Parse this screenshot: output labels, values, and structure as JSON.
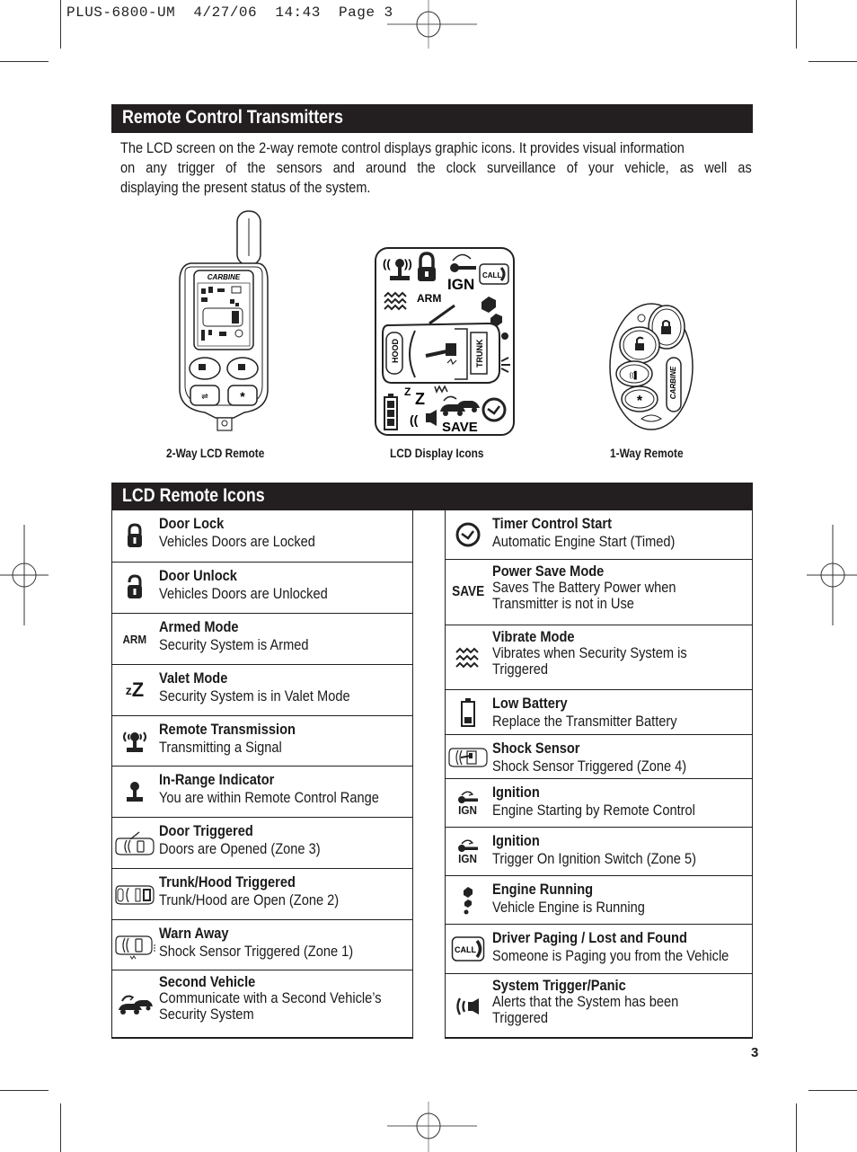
{
  "slug": {
    "text": "PLUS-6800-UM  4/27/06  14:43  Page 3"
  },
  "section1": {
    "title": "Remote Control Transmitters",
    "intro_lines": [
      "The LCD screen on the 2-way remote control displays graphic icons. It provides visual information",
      "on any trigger of the sensors and around the clock surveillance of your vehicle, as well as",
      "displaying the present status of the system."
    ]
  },
  "figures": {
    "two_way": {
      "caption": "2-Way LCD Remote",
      "brand": "CARBINE",
      "icon": "two-way-lcd-remote-illustration"
    },
    "lcd_display": {
      "caption": "LCD Display Icons",
      "labels": {
        "ign": "IGN",
        "call": "CALL",
        "arm": "ARM",
        "hood": "HOOD",
        "trunk": "TRUNK",
        "save": "SAVE",
        "z_small": "Z",
        "z_big": "Z"
      }
    },
    "one_way": {
      "caption": "1-Way Remote",
      "brand": "CARBINE",
      "icon": "one-way-remote-illustration"
    }
  },
  "section2": {
    "title": "LCD Remote Icons",
    "left_items": [
      {
        "icon": "lock-closed-icon",
        "title": "Door Lock",
        "desc": [
          "Vehicles Doors are Locked"
        ]
      },
      {
        "icon": "lock-open-icon",
        "title": "Door Unlock",
        "desc": [
          "Vehicles Doors are Unlocked"
        ]
      },
      {
        "icon": "arm-text-icon",
        "icon_text": "ARM",
        "title": "Armed Mode",
        "desc": [
          "Security System is Armed"
        ]
      },
      {
        "icon": "valet-zz-icon",
        "icon_text": "zZ",
        "title": "Valet Mode",
        "desc": [
          "Security System is in Valet Mode"
        ]
      },
      {
        "icon": "transmission-antenna-icon",
        "title": "Remote Transmission",
        "desc": [
          "Transmitting a Signal"
        ]
      },
      {
        "icon": "in-range-antenna-icon",
        "title": "In-Range Indicator",
        "desc": [
          "You are within Remote Control Range"
        ]
      },
      {
        "icon": "car-door-open-icon",
        "title": "Door Triggered",
        "desc": [
          "Doors are Opened (Zone 3)"
        ]
      },
      {
        "icon": "car-trunk-hood-icon",
        "title": "Trunk/Hood Triggered",
        "desc": [
          "Trunk/Hood are Open (Zone 2)"
        ]
      },
      {
        "icon": "car-warn-away-icon",
        "title": "Warn Away",
        "desc": [
          "Shock Sensor Triggered (Zone 1)"
        ]
      },
      {
        "icon": "second-vehicle-icon",
        "title": "Second Vehicle",
        "desc": [
          "Communicate with a Second Vehicle’s",
          "Security System"
        ]
      }
    ],
    "right_items": [
      {
        "icon": "clock-icon",
        "title": "Timer Control Start",
        "desc": [
          "Automatic Engine Start (Timed)"
        ]
      },
      {
        "icon": "save-text-icon",
        "icon_text": "SAVE",
        "title": "Power Save Mode",
        "desc": [
          "Saves The Battery Power when",
          "Transmitter is not in Use"
        ]
      },
      {
        "icon": "vibrate-waves-icon",
        "title": "Vibrate Mode",
        "desc": [
          "Vibrates when Security System is",
          "Triggered"
        ]
      },
      {
        "icon": "low-battery-icon",
        "title": "Low Battery",
        "desc": [
          "Replace the Transmitter Battery"
        ]
      },
      {
        "icon": "car-shock-sensor-icon",
        "title": "Shock Sensor",
        "desc": [
          "Shock Sensor Triggered (Zone 4)"
        ]
      },
      {
        "icon": "ignition-key-icon",
        "icon_text": "IGN",
        "title": "Ignition",
        "desc": [
          "Engine Starting by Remote Control"
        ]
      },
      {
        "icon": "ignition-key-icon",
        "icon_text": "IGN",
        "title": "Ignition",
        "desc": [
          "Trigger On Ignition Switch (Zone 5)"
        ]
      },
      {
        "icon": "engine-running-icon",
        "title": "Engine Running",
        "desc": [
          "Vehicle Engine is Running"
        ]
      },
      {
        "icon": "call-pager-icon",
        "icon_text": "CALL",
        "title": "Driver Paging / Lost and Found",
        "desc": [
          "Someone is Paging you from the Vehicle"
        ]
      },
      {
        "icon": "siren-panic-icon",
        "title": "System Trigger/Panic",
        "desc": [
          "Alerts that the System has been",
          "Triggered"
        ]
      }
    ]
  },
  "page_number": "3"
}
